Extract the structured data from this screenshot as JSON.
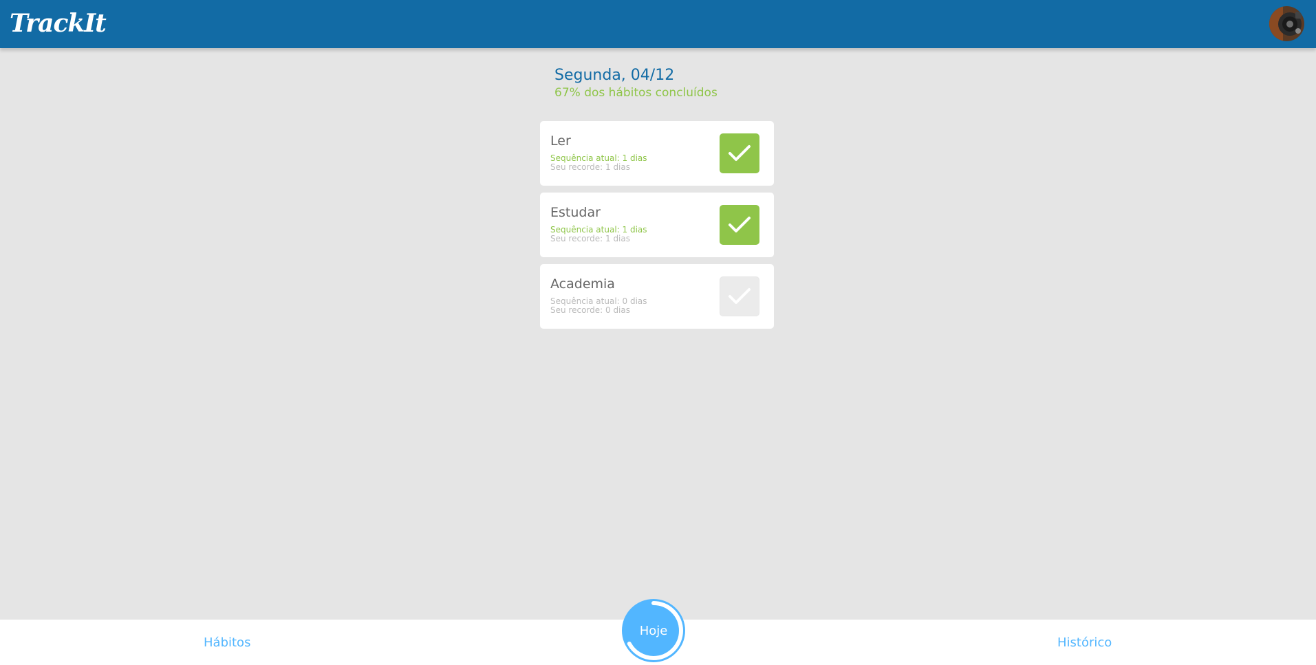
{
  "header": {
    "brand": "TrackIt",
    "avatar_icon": "user-avatar-photo"
  },
  "today": {
    "title": "Segunda, 04/12",
    "subtitle": "67% dos hábitos concluídos",
    "progress_percent": 67
  },
  "habits": [
    {
      "name": "Ler",
      "streak": "Sequência atual: 1 dias",
      "record": "Seu recorde: 1 dias",
      "done": true
    },
    {
      "name": "Estudar",
      "streak": "Sequência atual: 1 dias",
      "record": "Seu recorde: 1 dias",
      "done": true
    },
    {
      "name": "Academia",
      "streak": "Sequência atual: 0 dias",
      "record": "Seu recorde: 0 dias",
      "done": false
    }
  ],
  "nav": {
    "habits_label": "Hábitos",
    "today_label": "Hoje",
    "history_label": "Histórico"
  },
  "colors": {
    "primary": "#126BA5",
    "accent": "#52B6FF",
    "success": "#8FC549",
    "background": "#E5E5E5",
    "muted": "#BABABA"
  }
}
